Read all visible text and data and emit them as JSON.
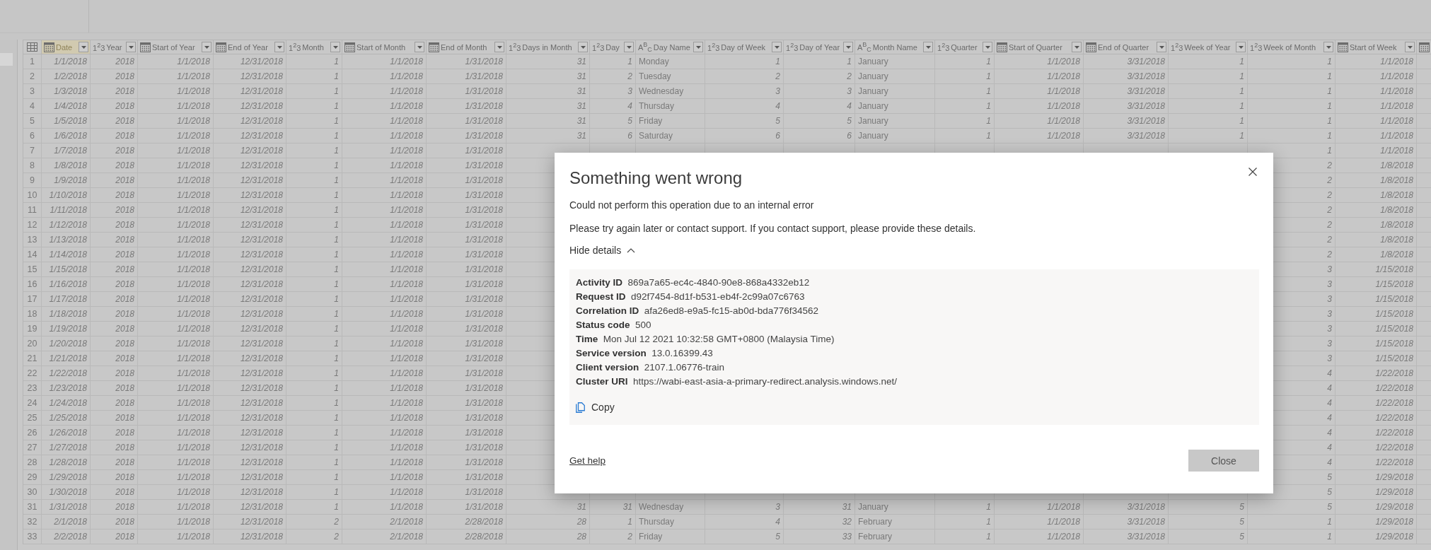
{
  "table": {
    "columns": [
      {
        "title": "Date",
        "kind": "date",
        "selected": true
      },
      {
        "title": "Year",
        "kind": "number",
        "type_label": "1$^{2}$3",
        "selected": false
      },
      {
        "title": "Start of Year",
        "kind": "date",
        "selected": false
      },
      {
        "title": "End of Year",
        "kind": "date",
        "selected": false
      },
      {
        "title": "Month",
        "kind": "number",
        "type_label": "1$^{2}$3",
        "selected": false
      },
      {
        "title": "Start of Month",
        "kind": "date",
        "selected": false
      },
      {
        "title": "End of Month",
        "kind": "date",
        "selected": false
      },
      {
        "title": "Days in Month",
        "kind": "number",
        "type_label": "1$^{2}$3",
        "selected": false
      },
      {
        "title": "Day",
        "kind": "number",
        "type_label": "1$^{2}$3",
        "selected": false
      },
      {
        "title": "Day Name",
        "kind": "text",
        "type_label": "A$^{B}$$_{C}$",
        "selected": false
      },
      {
        "title": "Day of Week",
        "kind": "number",
        "type_label": "1$^{2}$3",
        "selected": false
      },
      {
        "title": "Day of Year",
        "kind": "number",
        "type_label": "1$^{2}$3",
        "selected": false
      },
      {
        "title": "Month Name",
        "kind": "text",
        "type_label": "A$^{B}$$_{C}$",
        "selected": false
      },
      {
        "title": "Quarter",
        "kind": "number",
        "type_label": "1$^{2}$3",
        "selected": false
      },
      {
        "title": "Start of Quarter",
        "kind": "date",
        "selected": false
      },
      {
        "title": "End of Quarter",
        "kind": "date",
        "selected": false
      },
      {
        "title": "Week of Year",
        "kind": "number",
        "type_label": "1$^{2}$3",
        "selected": false
      },
      {
        "title": "Week of Month",
        "kind": "number",
        "type_label": "1$^{2}$3",
        "selected": false
      },
      {
        "title": "Start of Week",
        "kind": "date",
        "selected": false
      },
      {
        "kind": "date",
        "selected": false
      }
    ],
    "rows": [
      {
        "number": "1",
        "cells": [
          "1/1/2018",
          "2018",
          "1/1/2018",
          "12/31/2018",
          "1",
          "1/1/2018",
          "1/31/2018",
          "31",
          "1",
          "Monday",
          "1",
          "1",
          "January",
          "1",
          "1/1/2018",
          "3/31/2018",
          "1",
          "1",
          "1/1/2018"
        ]
      },
      {
        "number": "2",
        "cells": [
          "1/2/2018",
          "2018",
          "1/1/2018",
          "12/31/2018",
          "1",
          "1/1/2018",
          "1/31/2018",
          "31",
          "2",
          "Tuesday",
          "2",
          "2",
          "January",
          "1",
          "1/1/2018",
          "3/31/2018",
          "1",
          "1",
          "1/1/2018"
        ]
      },
      {
        "number": "3",
        "cells": [
          "1/3/2018",
          "2018",
          "1/1/2018",
          "12/31/2018",
          "1",
          "1/1/2018",
          "1/31/2018",
          "31",
          "3",
          "Wednesday",
          "3",
          "3",
          "January",
          "1",
          "1/1/2018",
          "3/31/2018",
          "1",
          "1",
          "1/1/2018"
        ]
      },
      {
        "number": "4",
        "cells": [
          "1/4/2018",
          "2018",
          "1/1/2018",
          "12/31/2018",
          "1",
          "1/1/2018",
          "1/31/2018",
          "31",
          "4",
          "Thursday",
          "4",
          "4",
          "January",
          "1",
          "1/1/2018",
          "3/31/2018",
          "1",
          "1",
          "1/1/2018"
        ]
      },
      {
        "number": "5",
        "cells": [
          "1/5/2018",
          "2018",
          "1/1/2018",
          "12/31/2018",
          "1",
          "1/1/2018",
          "1/31/2018",
          "31",
          "5",
          "Friday",
          "5",
          "5",
          "January",
          "1",
          "1/1/2018",
          "3/31/2018",
          "1",
          "1",
          "1/1/2018"
        ]
      },
      {
        "number": "6",
        "cells": [
          "1/6/2018",
          "2018",
          "1/1/2018",
          "12/31/2018",
          "1",
          "1/1/2018",
          "1/31/2018",
          "31",
          "6",
          "Saturday",
          "6",
          "6",
          "January",
          "1",
          "1/1/2018",
          "3/31/2018",
          "1",
          "1",
          "1/1/2018"
        ]
      },
      {
        "number": "7",
        "cells": [
          "1/7/2018",
          "2018",
          "1/1/2018",
          "12/31/2018",
          "1",
          "1/1/2018",
          "1/31/2018",
          null,
          null,
          null,
          null,
          null,
          null,
          null,
          null,
          null,
          null,
          "1",
          "1/1/2018"
        ]
      },
      {
        "number": "8",
        "cells": [
          "1/8/2018",
          "2018",
          "1/1/2018",
          "12/31/2018",
          "1",
          "1/1/2018",
          "1/31/2018",
          null,
          null,
          null,
          null,
          null,
          null,
          null,
          null,
          null,
          null,
          "2",
          "1/8/2018"
        ]
      },
      {
        "number": "9",
        "cells": [
          "1/9/2018",
          "2018",
          "1/1/2018",
          "12/31/2018",
          "1",
          "1/1/2018",
          "1/31/2018",
          null,
          null,
          null,
          null,
          null,
          null,
          null,
          null,
          null,
          null,
          "2",
          "1/8/2018"
        ]
      },
      {
        "number": "10",
        "cells": [
          "1/10/2018",
          "2018",
          "1/1/2018",
          "12/31/2018",
          "1",
          "1/1/2018",
          "1/31/2018",
          null,
          null,
          null,
          null,
          null,
          null,
          null,
          null,
          null,
          null,
          "2",
          "1/8/2018"
        ]
      },
      {
        "number": "11",
        "cells": [
          "1/11/2018",
          "2018",
          "1/1/2018",
          "12/31/2018",
          "1",
          "1/1/2018",
          "1/31/2018",
          null,
          null,
          null,
          null,
          null,
          null,
          null,
          null,
          null,
          null,
          "2",
          "1/8/2018"
        ]
      },
      {
        "number": "12",
        "cells": [
          "1/12/2018",
          "2018",
          "1/1/2018",
          "12/31/2018",
          "1",
          "1/1/2018",
          "1/31/2018",
          null,
          null,
          null,
          null,
          null,
          null,
          null,
          null,
          null,
          null,
          "2",
          "1/8/2018"
        ]
      },
      {
        "number": "13",
        "cells": [
          "1/13/2018",
          "2018",
          "1/1/2018",
          "12/31/2018",
          "1",
          "1/1/2018",
          "1/31/2018",
          null,
          null,
          null,
          null,
          null,
          null,
          null,
          null,
          null,
          null,
          "2",
          "1/8/2018"
        ]
      },
      {
        "number": "14",
        "cells": [
          "1/14/2018",
          "2018",
          "1/1/2018",
          "12/31/2018",
          "1",
          "1/1/2018",
          "1/31/2018",
          null,
          null,
          null,
          null,
          null,
          null,
          null,
          null,
          null,
          null,
          "2",
          "1/8/2018"
        ]
      },
      {
        "number": "15",
        "cells": [
          "1/15/2018",
          "2018",
          "1/1/2018",
          "12/31/2018",
          "1",
          "1/1/2018",
          "1/31/2018",
          null,
          null,
          null,
          null,
          null,
          null,
          null,
          null,
          null,
          null,
          "3",
          "1/15/2018"
        ]
      },
      {
        "number": "16",
        "cells": [
          "1/16/2018",
          "2018",
          "1/1/2018",
          "12/31/2018",
          "1",
          "1/1/2018",
          "1/31/2018",
          null,
          null,
          null,
          null,
          null,
          null,
          null,
          null,
          null,
          null,
          "3",
          "1/15/2018"
        ]
      },
      {
        "number": "17",
        "cells": [
          "1/17/2018",
          "2018",
          "1/1/2018",
          "12/31/2018",
          "1",
          "1/1/2018",
          "1/31/2018",
          null,
          null,
          null,
          null,
          null,
          null,
          null,
          null,
          null,
          null,
          "3",
          "1/15/2018"
        ]
      },
      {
        "number": "18",
        "cells": [
          "1/18/2018",
          "2018",
          "1/1/2018",
          "12/31/2018",
          "1",
          "1/1/2018",
          "1/31/2018",
          null,
          null,
          null,
          null,
          null,
          null,
          null,
          null,
          null,
          null,
          "3",
          "1/15/2018"
        ]
      },
      {
        "number": "19",
        "cells": [
          "1/19/2018",
          "2018",
          "1/1/2018",
          "12/31/2018",
          "1",
          "1/1/2018",
          "1/31/2018",
          null,
          null,
          null,
          null,
          null,
          null,
          null,
          null,
          null,
          null,
          "3",
          "1/15/2018"
        ]
      },
      {
        "number": "20",
        "cells": [
          "1/20/2018",
          "2018",
          "1/1/2018",
          "12/31/2018",
          "1",
          "1/1/2018",
          "1/31/2018",
          null,
          null,
          null,
          null,
          null,
          null,
          null,
          null,
          null,
          null,
          "3",
          "1/15/2018"
        ]
      },
      {
        "number": "21",
        "cells": [
          "1/21/2018",
          "2018",
          "1/1/2018",
          "12/31/2018",
          "1",
          "1/1/2018",
          "1/31/2018",
          null,
          null,
          null,
          null,
          null,
          null,
          null,
          null,
          null,
          null,
          "3",
          "1/15/2018"
        ]
      },
      {
        "number": "22",
        "cells": [
          "1/22/2018",
          "2018",
          "1/1/2018",
          "12/31/2018",
          "1",
          "1/1/2018",
          "1/31/2018",
          null,
          null,
          null,
          null,
          null,
          null,
          null,
          null,
          null,
          null,
          "4",
          "1/22/2018"
        ]
      },
      {
        "number": "23",
        "cells": [
          "1/23/2018",
          "2018",
          "1/1/2018",
          "12/31/2018",
          "1",
          "1/1/2018",
          "1/31/2018",
          null,
          null,
          null,
          null,
          null,
          null,
          null,
          null,
          null,
          null,
          "4",
          "1/22/2018"
        ]
      },
      {
        "number": "24",
        "cells": [
          "1/24/2018",
          "2018",
          "1/1/2018",
          "12/31/2018",
          "1",
          "1/1/2018",
          "1/31/2018",
          null,
          null,
          null,
          null,
          null,
          null,
          null,
          null,
          null,
          null,
          "4",
          "1/22/2018"
        ]
      },
      {
        "number": "25",
        "cells": [
          "1/25/2018",
          "2018",
          "1/1/2018",
          "12/31/2018",
          "1",
          "1/1/2018",
          "1/31/2018",
          null,
          null,
          null,
          null,
          null,
          null,
          null,
          null,
          null,
          null,
          "4",
          "1/22/2018"
        ]
      },
      {
        "number": "26",
        "cells": [
          "1/26/2018",
          "2018",
          "1/1/2018",
          "12/31/2018",
          "1",
          "1/1/2018",
          "1/31/2018",
          null,
          null,
          null,
          null,
          null,
          null,
          null,
          null,
          null,
          null,
          "4",
          "1/22/2018"
        ]
      },
      {
        "number": "27",
        "cells": [
          "1/27/2018",
          "2018",
          "1/1/2018",
          "12/31/2018",
          "1",
          "1/1/2018",
          "1/31/2018",
          null,
          null,
          null,
          null,
          null,
          null,
          null,
          null,
          null,
          null,
          "4",
          "1/22/2018"
        ]
      },
      {
        "number": "28",
        "cells": [
          "1/28/2018",
          "2018",
          "1/1/2018",
          "12/31/2018",
          "1",
          "1/1/2018",
          "1/31/2018",
          null,
          null,
          null,
          null,
          null,
          null,
          null,
          null,
          null,
          null,
          "4",
          "1/22/2018"
        ]
      },
      {
        "number": "29",
        "cells": [
          "1/29/2018",
          "2018",
          "1/1/2018",
          "12/31/2018",
          "1",
          "1/1/2018",
          "1/31/2018",
          null,
          null,
          null,
          null,
          null,
          null,
          null,
          null,
          null,
          null,
          "5",
          "1/29/2018"
        ]
      },
      {
        "number": "30",
        "cells": [
          "1/30/2018",
          "2018",
          "1/1/2018",
          "12/31/2018",
          "1",
          "1/1/2018",
          "1/31/2018",
          null,
          null,
          null,
          null,
          null,
          null,
          null,
          null,
          null,
          null,
          "5",
          "1/29/2018"
        ]
      },
      {
        "number": "31",
        "cells": [
          "1/31/2018",
          "2018",
          "1/1/2018",
          "12/31/2018",
          "1",
          "1/1/2018",
          "1/31/2018",
          "31",
          "31",
          "Wednesday",
          "3",
          "31",
          "January",
          "1",
          "1/1/2018",
          "3/31/2018",
          "5",
          "5",
          "1/29/2018"
        ]
      },
      {
        "number": "32",
        "cells": [
          "2/1/2018",
          "2018",
          "1/1/2018",
          "12/31/2018",
          "2",
          "2/1/2018",
          "2/28/2018",
          "28",
          "1",
          "Thursday",
          "4",
          "32",
          "February",
          "1",
          "1/1/2018",
          "3/31/2018",
          "5",
          "1",
          "1/29/2018"
        ]
      },
      {
        "number": "33",
        "cells": [
          "2/2/2018",
          "2018",
          "1/1/2018",
          "12/31/2018",
          "2",
          "2/1/2018",
          "2/28/2018",
          "28",
          "2",
          "Friday",
          "5",
          "33",
          "February",
          "1",
          "1/1/2018",
          "3/31/2018",
          "5",
          "1",
          "1/29/2018"
        ]
      }
    ]
  },
  "dialog": {
    "title": "Something went wrong",
    "message": "Could not perform this operation due to an internal error",
    "instruction": "Please try again later or contact support. If you contact support, please provide these details.",
    "details_toggle": "Hide details",
    "expanded": true,
    "details": [
      {
        "label": "Activity ID",
        "value": "869a7a65-ec4c-4840-90e8-868a4332eb12"
      },
      {
        "label": "Request ID",
        "value": "d92f7454-8d1f-b531-eb4f-2c99a07c6763"
      },
      {
        "label": "Correlation ID",
        "value": "afa26ed8-e9a5-fc15-ab0d-bda776f34562"
      },
      {
        "label": "Status code",
        "value": "500"
      },
      {
        "label": "Time",
        "value": "Mon Jul 12 2021 10:32:58 GMT+0800 (Malaysia Time)"
      },
      {
        "label": "Service version",
        "value": "13.0.16399.43"
      },
      {
        "label": "Client version",
        "value": "2107.1.06776-train"
      },
      {
        "label": "Cluster URI",
        "value": "https://wabi-east-asia-a-primary-redirect.analysis.windows.net/"
      }
    ],
    "copy_label": "Copy",
    "help_link": "Get help",
    "close_button": "Close"
  }
}
